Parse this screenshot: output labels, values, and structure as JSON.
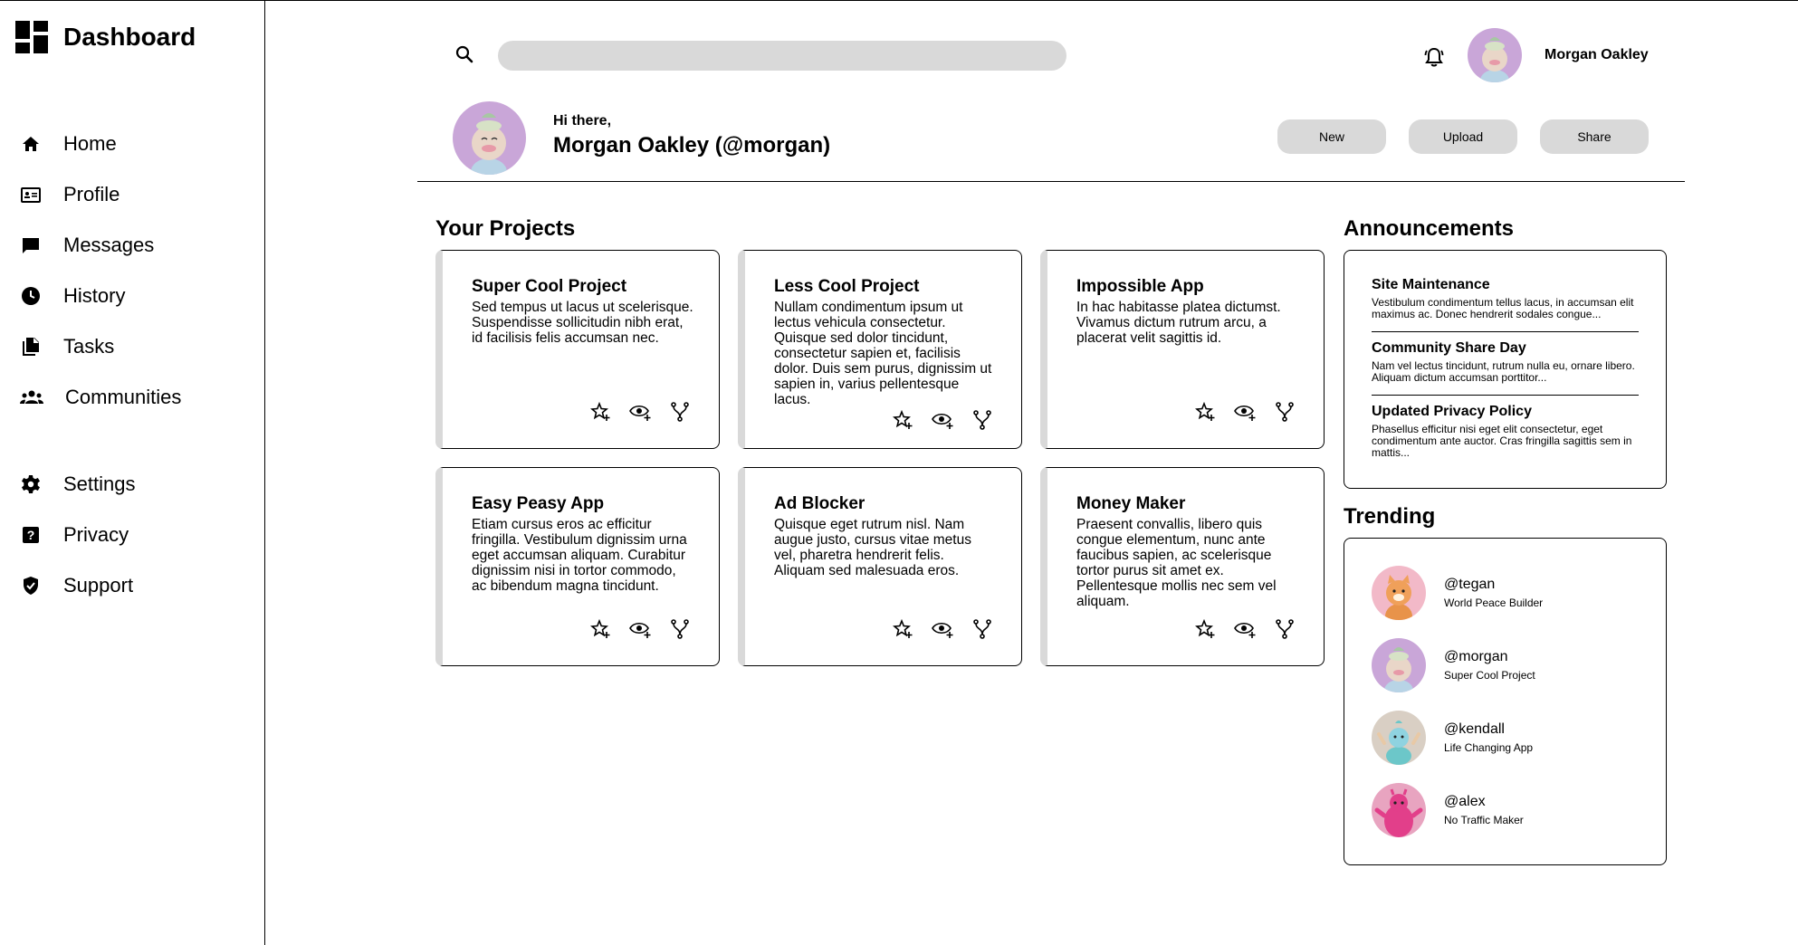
{
  "app": {
    "title": "Dashboard"
  },
  "sidebar": {
    "items": [
      {
        "label": "Home",
        "icon": "home-icon"
      },
      {
        "label": "Profile",
        "icon": "id-card-icon"
      },
      {
        "label": "Messages",
        "icon": "message-icon"
      },
      {
        "label": "History",
        "icon": "clock-icon"
      },
      {
        "label": "Tasks",
        "icon": "documents-icon"
      },
      {
        "label": "Communities",
        "icon": "people-icon"
      }
    ],
    "secondary": [
      {
        "label": "Settings",
        "icon": "gear-icon"
      },
      {
        "label": "Privacy",
        "icon": "help-icon"
      },
      {
        "label": "Support",
        "icon": "shield-icon"
      }
    ]
  },
  "topbar": {
    "search_placeholder": "",
    "user_name": "Morgan Oakley"
  },
  "greeting": {
    "hello": "Hi there,",
    "name": "Morgan Oakley (@morgan)"
  },
  "actions": {
    "new": "New",
    "upload": "Upload",
    "share": "Share"
  },
  "projects": {
    "title": "Your Projects",
    "items": [
      {
        "title": "Super Cool Project",
        "desc": "Sed tempus ut lacus ut scelerisque. Suspendisse sollicitudin nibh erat, id facilisis felis accumsan nec."
      },
      {
        "title": "Less Cool Project",
        "desc": "Nullam condimentum ipsum ut lectus vehicula consectetur. Quisque sed dolor tincidunt, consectetur sapien et, facilisis dolor. Duis sem purus, dignissim ut sapien in, varius pellentesque lacus."
      },
      {
        "title": "Impossible App",
        "desc": "In hac habitasse platea dictumst. Vivamus dictum rutrum arcu, a placerat velit sagittis id."
      },
      {
        "title": "Easy Peasy App",
        "desc": "Etiam cursus eros ac efficitur fringilla. Vestibulum dignissim urna eget accumsan aliquam. Curabitur dignissim nisi in tortor commodo, ac bibendum magna tincidunt."
      },
      {
        "title": "Ad Blocker",
        "desc": "Quisque eget rutrum nisl. Nam augue justo, cursus vitae metus vel, pharetra hendrerit felis. Aliquam sed malesuada eros."
      },
      {
        "title": "Money Maker",
        "desc": "Praesent convallis, libero quis congue elementum, nunc ante faucibus sapien, ac scelerisque tortor purus sit amet ex. Pellentesque mollis nec sem vel aliquam."
      }
    ]
  },
  "announcements": {
    "title": "Announcements",
    "items": [
      {
        "title": "Site Maintenance",
        "desc": "Vestibulum condimentum tellus lacus, in accumsan elit maximus ac. Donec hendrerit sodales congue..."
      },
      {
        "title": "Community Share Day",
        "desc": "Nam vel lectus tincidunt, rutrum nulla eu, ornare libero. Aliquam dictum accumsan porttitor..."
      },
      {
        "title": "Updated Privacy Policy",
        "desc": "Phasellus efficitur nisi eget elit consectetur, eget condimentum ante auctor. Cras fringilla sagittis sem in mattis..."
      }
    ]
  },
  "trending": {
    "title": "Trending",
    "items": [
      {
        "handle": "@tegan",
        "project": "World Peace Builder",
        "avatar_color": "#f2b9c8"
      },
      {
        "handle": "@morgan",
        "project": "Super Cool Project",
        "avatar_color": "#c9a6d8"
      },
      {
        "handle": "@kendall",
        "project": "Life Changing App",
        "avatar_color": "#d9cfc4"
      },
      {
        "handle": "@alex",
        "project": "No Traffic Maker",
        "avatar_color": "#e8a4c0"
      }
    ]
  },
  "colors": {
    "button_gray": "#d9d9d9",
    "border": "#000000"
  }
}
